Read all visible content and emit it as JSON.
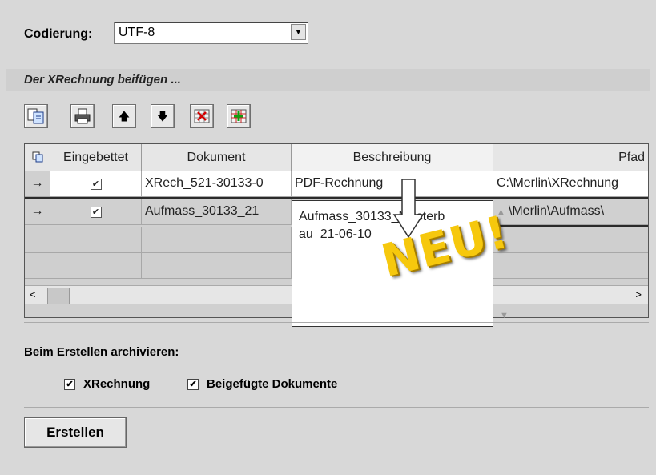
{
  "encoding": {
    "label": "Codierung:",
    "value": "UTF-8"
  },
  "attach_section": {
    "title": "Der XRechnung beifügen ..."
  },
  "toolbar": {
    "icons": [
      "copy-icon",
      "print-icon",
      "move-up-icon",
      "move-down-icon",
      "delete-icon",
      "add-icon"
    ],
    "up_glyph": "🡅",
    "down_glyph": "🡇"
  },
  "grid": {
    "columns": [
      "Eingebettet",
      "Dokument",
      "Beschreibung",
      "Pfad"
    ],
    "rows": [
      {
        "marker": "→",
        "embedded": true,
        "document": "XRech_521-30133-0",
        "description": "PDF-Rechnung",
        "path": "C:\\Merlin\\XRechnung"
      },
      {
        "marker": "→",
        "embedded": true,
        "document": "Aufmass_30133_21",
        "description": "",
        "path": "\\Merlin\\Aufmass\\"
      }
    ],
    "editor_text_line1": "Aufmass_30133_Musterb",
    "editor_text_line2": "au_21-06-10",
    "scroll_left": "<",
    "scroll_right": ">"
  },
  "overlay": {
    "badge": "NEU!"
  },
  "archive": {
    "label": "Beim Erstellen archivieren:",
    "options": [
      {
        "label": "XRechnung",
        "checked": true
      },
      {
        "label": "Beigefügte Dokumente",
        "checked": true
      }
    ]
  },
  "create_button": {
    "label": "Erstellen"
  }
}
